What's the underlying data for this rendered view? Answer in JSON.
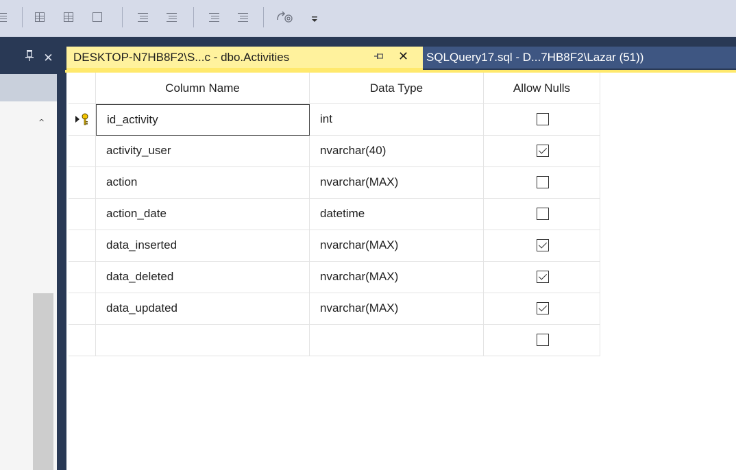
{
  "toolbar": {
    "icons": [
      "set-primary-key-icon",
      "relationships-icon",
      "manage-indexes-icon",
      "manage-fulltext-icon",
      "manage-xml-indexes-icon",
      "check-constraints-icon",
      "spatial-indexes-icon",
      "generate-change-script-icon",
      "comment-icon",
      "uncomment-icon",
      "decrease-indent-icon",
      "increase-indent-icon",
      "insert-snippet-icon",
      "toolbar-options-icon"
    ]
  },
  "left_panel": {
    "pin_glyph": "ꟸ",
    "close_glyph": "✕",
    "scroll_up_glyph": "^"
  },
  "tabs": [
    {
      "title": "DESKTOP-N7HB8F2\\S...c - dbo.Activities",
      "active": true,
      "pin_glyph": "⊣",
      "close_glyph": "✕"
    },
    {
      "title": "SQLQuery17.sql - D...7HB8F2\\Lazar (51))",
      "active": false
    }
  ],
  "grid": {
    "headers": {
      "name": "Column Name",
      "type": "Data Type",
      "nulls": "Allow Nulls"
    },
    "rows": [
      {
        "name": "id_activity",
        "type": "int",
        "allow_nulls": false,
        "primary_key": true
      },
      {
        "name": "activity_user",
        "type": "nvarchar(40)",
        "allow_nulls": true
      },
      {
        "name": "action",
        "type": "nvarchar(MAX)",
        "allow_nulls": false
      },
      {
        "name": "action_date",
        "type": "datetime",
        "allow_nulls": false
      },
      {
        "name": "data_inserted",
        "type": "nvarchar(MAX)",
        "allow_nulls": true
      },
      {
        "name": "data_deleted",
        "type": "nvarchar(MAX)",
        "allow_nulls": true
      },
      {
        "name": "data_updated",
        "type": "nvarchar(MAX)",
        "allow_nulls": true
      },
      {
        "name": "",
        "type": "",
        "allow_nulls": false
      }
    ]
  },
  "colors": {
    "frame": "#293955",
    "active_tab": "#fff29d",
    "inactive_tab": "#3e5682",
    "toolbar": "#d6dbe9"
  }
}
